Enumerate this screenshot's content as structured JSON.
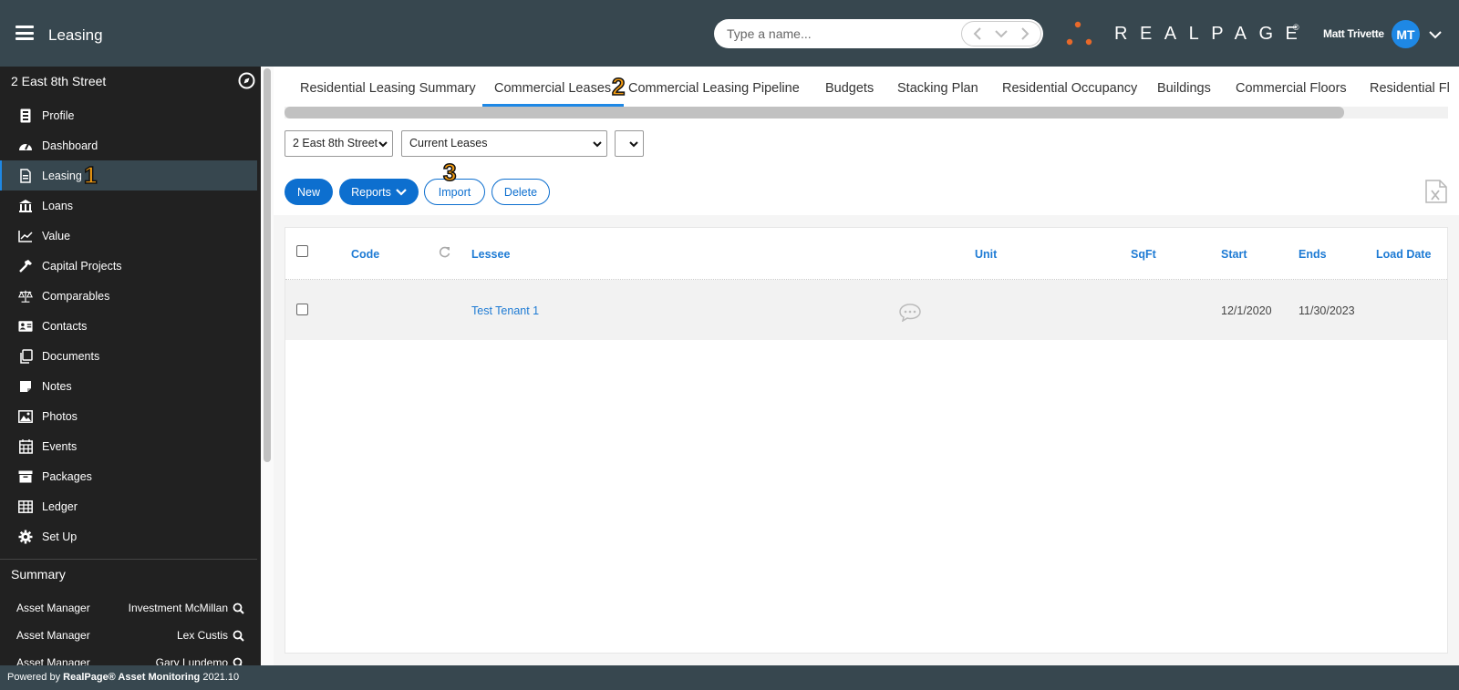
{
  "header": {
    "app_title": "Leasing",
    "search_placeholder": "Type a name...",
    "logo_text": "REALPAGE",
    "logo_mark": "®",
    "user_name": "Matt Trivette",
    "user_initials": "MT",
    "colors": {
      "header_bg": "#37474f",
      "accent": "#1e88e5",
      "logo_dots": "#e8692a"
    }
  },
  "sidebar": {
    "property": "2 East 8th Street",
    "items": [
      {
        "label": "Profile",
        "icon": "profile-icon"
      },
      {
        "label": "Dashboard",
        "icon": "dashboard-icon"
      },
      {
        "label": "Leasing",
        "icon": "leasing-icon",
        "active": true
      },
      {
        "label": "Loans",
        "icon": "bank-icon"
      },
      {
        "label": "Value",
        "icon": "chart-line-icon"
      },
      {
        "label": "Capital Projects",
        "icon": "hammer-icon"
      },
      {
        "label": "Comparables",
        "icon": "scale-icon"
      },
      {
        "label": "Contacts",
        "icon": "contact-card-icon"
      },
      {
        "label": "Documents",
        "icon": "documents-icon"
      },
      {
        "label": "Notes",
        "icon": "note-icon"
      },
      {
        "label": "Photos",
        "icon": "photo-icon"
      },
      {
        "label": "Events",
        "icon": "calendar-icon"
      },
      {
        "label": "Packages",
        "icon": "package-icon"
      },
      {
        "label": "Ledger",
        "icon": "table-icon"
      },
      {
        "label": "Set Up",
        "icon": "gear-icon"
      }
    ],
    "summary": {
      "title": "Summary",
      "rows": [
        {
          "role": "Asset Manager",
          "name": "Investment McMillan"
        },
        {
          "role": "Asset Manager",
          "name": "Lex Custis"
        },
        {
          "role": "Asset Manager",
          "name": "Gary Lundemo"
        }
      ]
    }
  },
  "tabs": [
    {
      "label": "Residential Leasing Summary"
    },
    {
      "label": "Commercial Leases",
      "active": true
    },
    {
      "label": "Commercial Leasing Pipeline"
    },
    {
      "label": "Budgets"
    },
    {
      "label": "Stacking Plan"
    },
    {
      "label": "Residential Occupancy"
    },
    {
      "label": "Buildings"
    },
    {
      "label": "Commercial Floors"
    },
    {
      "label": "Residential Fl"
    }
  ],
  "filters": {
    "property": "2 East 8th Street",
    "lease_view": "Current Leases",
    "extra": ""
  },
  "toolbar": {
    "new_label": "New",
    "reports_label": "Reports",
    "import_label": "Import",
    "delete_label": "Delete"
  },
  "grid": {
    "columns": [
      "Code",
      "Lessee",
      "Unit",
      "SqFt",
      "Start",
      "Ends",
      "Load Date"
    ],
    "rows": [
      {
        "code": "",
        "lessee": "Test Tenant 1",
        "unit": "",
        "sqft": "",
        "start": "12/1/2020",
        "ends": "11/30/2023",
        "load_date": ""
      }
    ]
  },
  "callouts": {
    "one": "1",
    "two": "2",
    "three": "3"
  },
  "footer": {
    "prefix": "Powered by",
    "brand": "RealPage® Asset Monitoring",
    "version": "2021.10"
  }
}
